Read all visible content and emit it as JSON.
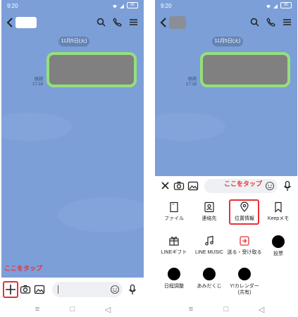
{
  "status_bar": {
    "time": "9:20",
    "battery": "80"
  },
  "chat": {
    "date": "11月5日(火)",
    "read_label": "既読",
    "read_time": "17:18"
  },
  "annotation_left": "ここをタップ",
  "annotation_right": "ここをタップ",
  "menu": [
    {
      "label": "ファイル",
      "icon": "file-icon"
    },
    {
      "label": "連絡先",
      "icon": "contact-icon"
    },
    {
      "label": "位置情報",
      "icon": "location-pin-icon"
    },
    {
      "label": "Keepメモ",
      "icon": "bookmark-icon"
    },
    {
      "label": "LINEギフト",
      "icon": "gift-icon"
    },
    {
      "label": "LINE MUSIC",
      "icon": "music-note-icon"
    },
    {
      "label": "送る・受け取る",
      "icon": "send-receive-icon"
    },
    {
      "label": "投票",
      "icon": "black-circle-icon"
    },
    {
      "label": "日程調整",
      "icon": "black-circle-icon"
    },
    {
      "label": "あみだくじ",
      "icon": "black-circle-icon"
    },
    {
      "label": "Y!カレンダー",
      "icon": "black-circle-icon"
    },
    {
      "label": "(共有)",
      "icon": ""
    }
  ],
  "colors": {
    "chat_bg": "#7c9fd8",
    "bubble_border": "#94e07a",
    "highlight": "#e8303a",
    "date_pill": "#6584b4"
  }
}
